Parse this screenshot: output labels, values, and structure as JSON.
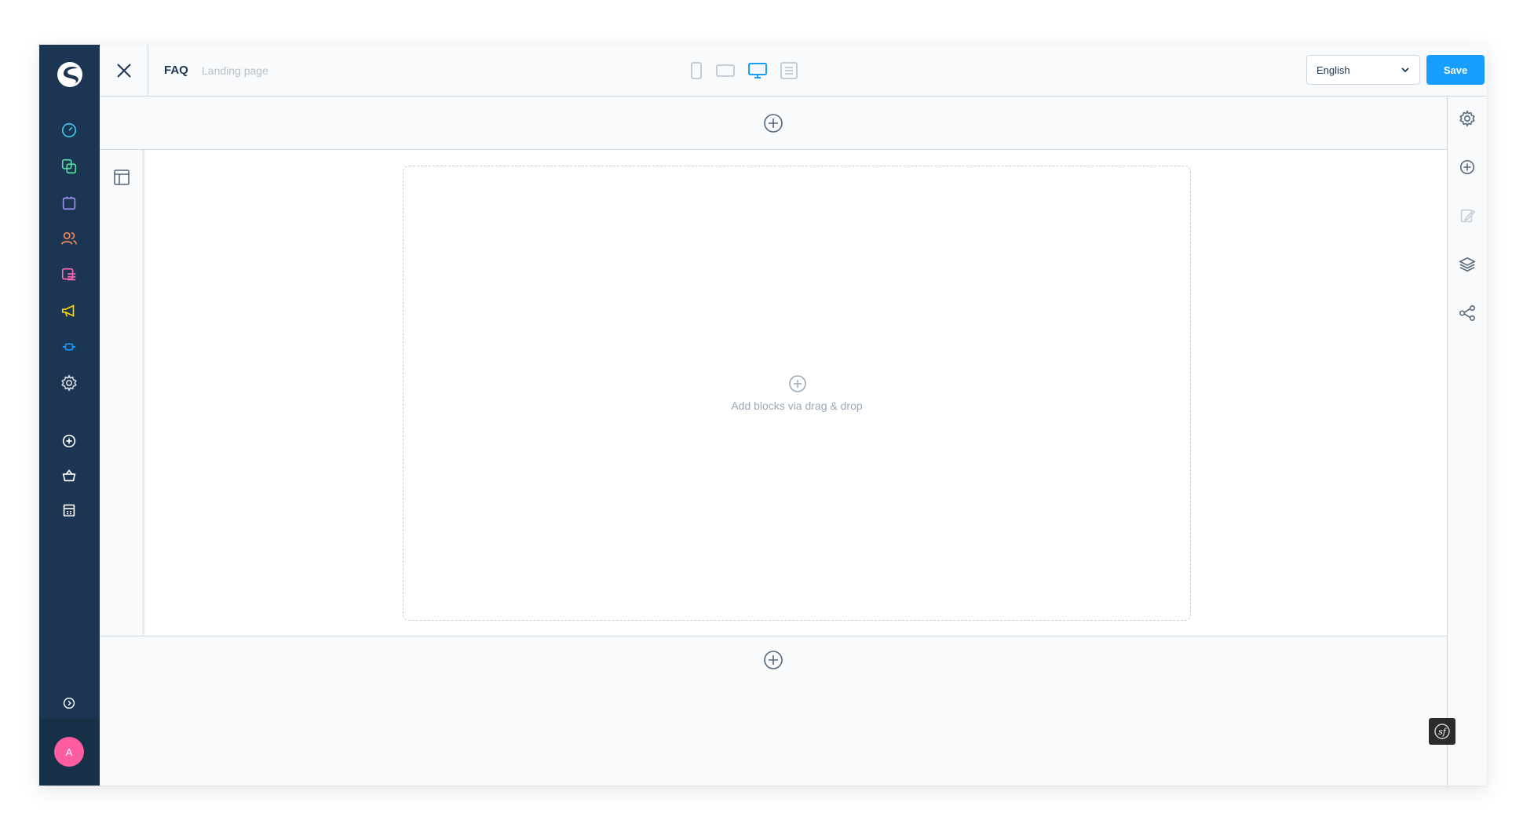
{
  "header": {
    "title": "FAQ",
    "subtitle": "Landing page",
    "language": "English",
    "save_label": "Save",
    "view_modes": [
      "mobile-view-icon",
      "tablet-view-icon",
      "desktop-view-icon",
      "form-view-icon"
    ],
    "active_view": "desktop-view-icon"
  },
  "sidebar": {
    "items": [
      {
        "name": "dashboard",
        "icon": "gauge-icon",
        "color": "#3fc8ea"
      },
      {
        "name": "catalogues",
        "icon": "stack-icon",
        "color": "#57d9a3"
      },
      {
        "name": "orders",
        "icon": "shopping-bag-icon",
        "color": "#a092f0"
      },
      {
        "name": "customers",
        "icon": "users-icon",
        "color": "#f88962"
      },
      {
        "name": "content",
        "icon": "content-icon",
        "color": "#ff68b4"
      },
      {
        "name": "marketing",
        "icon": "megaphone-icon",
        "color": "#ffd700"
      },
      {
        "name": "extensions",
        "icon": "plug-icon",
        "color": "#189eff"
      },
      {
        "name": "settings",
        "icon": "gear-icon",
        "color": "#d1d9e0"
      },
      {
        "name": "add",
        "icon": "plus-circle-icon",
        "color": "#ffffff"
      },
      {
        "name": "sales-channel",
        "icon": "basket-icon",
        "color": "#ffffff"
      },
      {
        "name": "storefront",
        "icon": "store-icon",
        "color": "#ffffff"
      }
    ],
    "expand_icon": "chevron-right-circle-icon",
    "avatar_initial": "A",
    "avatar_color": "#ff5da2"
  },
  "stage": {
    "dropzone_text": "Add blocks via drag & drop"
  },
  "right_bar": {
    "items": [
      "gear-icon",
      "plus-circle-icon",
      "edit-icon",
      "layers-icon",
      "share-icon"
    ]
  },
  "colors": {
    "sidebar_bg": "#1b3552",
    "accent": "#189eff",
    "border": "#d1d9e0"
  }
}
